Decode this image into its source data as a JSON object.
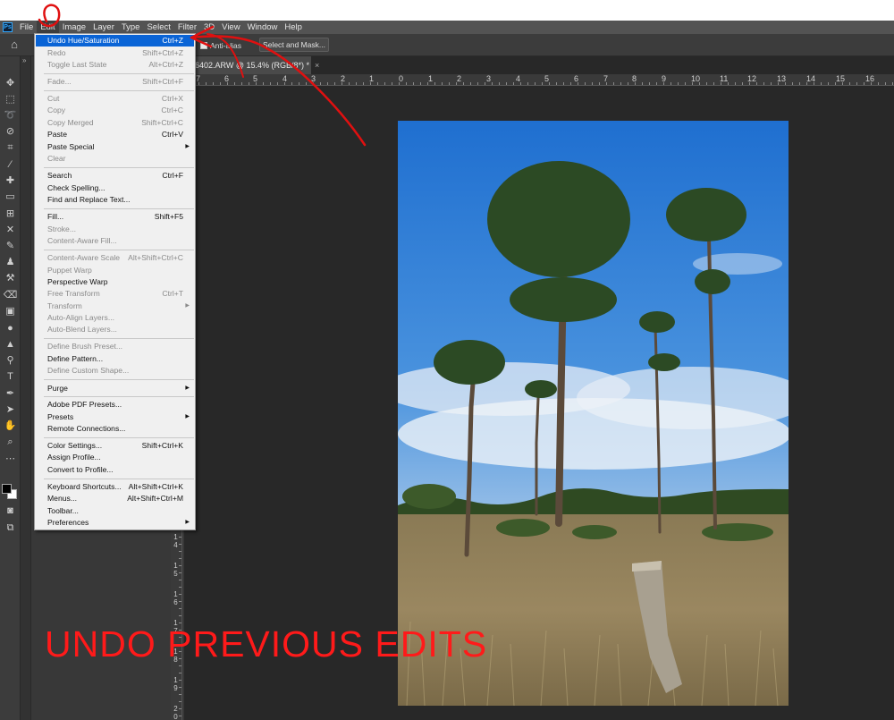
{
  "app_icon": "Ps",
  "menubar": [
    "File",
    "Edit",
    "Image",
    "Layer",
    "Type",
    "Select",
    "Filter",
    "3D",
    "View",
    "Window",
    "Help"
  ],
  "options_bar": {
    "antialias_label": "Anti-alias",
    "select_mask_label": "Select and Mask..."
  },
  "document_tab": {
    "title": "6402.ARW @ 15.4% (RGB/8*) *",
    "close": "×"
  },
  "ruler": {
    "horizontal": [
      "7",
      "6",
      "5",
      "4",
      "3",
      "2",
      "1",
      "0",
      "1",
      "2",
      "3",
      "4",
      "5",
      "6",
      "7",
      "8",
      "9",
      "10",
      "11",
      "12",
      "13",
      "14",
      "15",
      "16"
    ],
    "vertical": [
      "1 4",
      "1 5",
      "1 6",
      "1 7",
      "1 8",
      "1 9",
      "2 0"
    ]
  },
  "edit_menu": {
    "items": [
      {
        "label": "Undo Hue/Saturation",
        "shortcut": "Ctrl+Z",
        "state": "highlighted"
      },
      {
        "label": "Redo",
        "shortcut": "Shift+Ctrl+Z",
        "state": "disabled"
      },
      {
        "label": "Toggle Last State",
        "shortcut": "Alt+Ctrl+Z",
        "state": "disabled"
      },
      {
        "label": "Fade...",
        "shortcut": "Shift+Ctrl+F",
        "state": "disabled"
      },
      {
        "label": "Cut",
        "shortcut": "Ctrl+X",
        "state": "disabled"
      },
      {
        "label": "Copy",
        "shortcut": "Ctrl+C",
        "state": "disabled"
      },
      {
        "label": "Copy Merged",
        "shortcut": "Shift+Ctrl+C",
        "state": "disabled"
      },
      {
        "label": "Paste",
        "shortcut": "Ctrl+V",
        "state": "enabled"
      },
      {
        "label": "Paste Special",
        "shortcut": "",
        "state": "enabled",
        "submenu": true
      },
      {
        "label": "Clear",
        "shortcut": "",
        "state": "disabled"
      },
      {
        "label": "Search",
        "shortcut": "Ctrl+F",
        "state": "enabled"
      },
      {
        "label": "Check Spelling...",
        "shortcut": "",
        "state": "enabled"
      },
      {
        "label": "Find and Replace Text...",
        "shortcut": "",
        "state": "enabled"
      },
      {
        "label": "Fill...",
        "shortcut": "Shift+F5",
        "state": "enabled"
      },
      {
        "label": "Stroke...",
        "shortcut": "",
        "state": "disabled"
      },
      {
        "label": "Content-Aware Fill...",
        "shortcut": "",
        "state": "disabled"
      },
      {
        "label": "Content-Aware Scale",
        "shortcut": "Alt+Shift+Ctrl+C",
        "state": "disabled"
      },
      {
        "label": "Puppet Warp",
        "shortcut": "",
        "state": "disabled"
      },
      {
        "label": "Perspective Warp",
        "shortcut": "",
        "state": "enabled"
      },
      {
        "label": "Free Transform",
        "shortcut": "Ctrl+T",
        "state": "disabled"
      },
      {
        "label": "Transform",
        "shortcut": "",
        "state": "disabled",
        "submenu": true
      },
      {
        "label": "Auto-Align Layers...",
        "shortcut": "",
        "state": "disabled"
      },
      {
        "label": "Auto-Blend Layers...",
        "shortcut": "",
        "state": "disabled"
      },
      {
        "label": "Define Brush Preset...",
        "shortcut": "",
        "state": "disabled"
      },
      {
        "label": "Define Pattern...",
        "shortcut": "",
        "state": "enabled"
      },
      {
        "label": "Define Custom Shape...",
        "shortcut": "",
        "state": "disabled"
      },
      {
        "label": "Purge",
        "shortcut": "",
        "state": "enabled",
        "submenu": true
      },
      {
        "label": "Adobe PDF Presets...",
        "shortcut": "",
        "state": "enabled"
      },
      {
        "label": "Presets",
        "shortcut": "",
        "state": "enabled",
        "submenu": true
      },
      {
        "label": "Remote Connections...",
        "shortcut": "",
        "state": "enabled"
      },
      {
        "label": "Color Settings...",
        "shortcut": "Shift+Ctrl+K",
        "state": "enabled"
      },
      {
        "label": "Assign Profile...",
        "shortcut": "",
        "state": "enabled"
      },
      {
        "label": "Convert to Profile...",
        "shortcut": "",
        "state": "enabled"
      },
      {
        "label": "Keyboard Shortcuts...",
        "shortcut": "Alt+Shift+Ctrl+K",
        "state": "enabled"
      },
      {
        "label": "Menus...",
        "shortcut": "Alt+Shift+Ctrl+M",
        "state": "enabled"
      },
      {
        "label": "Toolbar...",
        "shortcut": "",
        "state": "enabled"
      },
      {
        "label": "Preferences",
        "shortcut": "",
        "state": "enabled",
        "submenu": true
      }
    ]
  },
  "annotation": {
    "caption": "UNDO PREVIOUS EDITS",
    "color": "#ff1a1a"
  },
  "tools": [
    "move-icon",
    "marquee-icon",
    "lasso-icon",
    "quick-select-icon",
    "crop-icon",
    "eyedropper-icon",
    "healing-icon",
    "brush-icon",
    "stamp-icon",
    "history-brush-icon",
    "eraser-icon",
    "gradient-icon",
    "blur-icon",
    "dodge-icon",
    "pen-icon",
    "type-icon",
    "path-select-icon",
    "hand-icon",
    "zoom-icon",
    "more-icon"
  ]
}
